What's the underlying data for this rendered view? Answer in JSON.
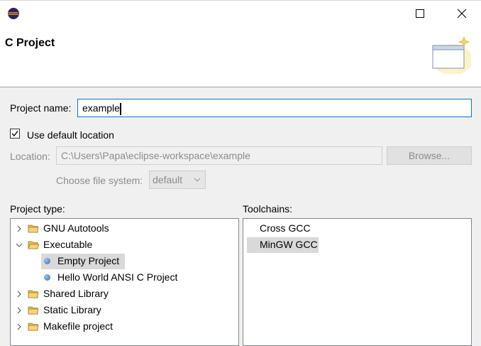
{
  "window": {
    "title": "C Project",
    "icon": "eclipse-icon",
    "controls": [
      "maximize-icon",
      "close-icon"
    ]
  },
  "form": {
    "project_name_label": "Project name:",
    "project_name_value": "example",
    "use_default_location_label": "Use default location",
    "use_default_location_checked": true,
    "location_label": "Location:",
    "location_value": "C:\\Users\\Papa\\eclipse-workspace\\example",
    "browse_label": "Browse...",
    "file_system_label": "Choose file system:",
    "file_system_value": "default"
  },
  "project_type": {
    "label": "Project type:",
    "items": [
      {
        "label": "GNU Autotools",
        "kind": "folder",
        "expanded": false
      },
      {
        "label": "Executable",
        "kind": "folder",
        "expanded": true
      },
      {
        "label": "Empty Project",
        "kind": "template",
        "selected": true
      },
      {
        "label": "Hello World ANSI C Project",
        "kind": "template",
        "selected": false
      },
      {
        "label": "Shared Library",
        "kind": "folder",
        "expanded": false
      },
      {
        "label": "Static Library",
        "kind": "folder",
        "expanded": false
      },
      {
        "label": "Makefile project",
        "kind": "folder",
        "expanded": false
      }
    ]
  },
  "toolchains": {
    "label": "Toolchains:",
    "items": [
      {
        "label": "Cross GCC",
        "selected": false
      },
      {
        "label": "MinGW GCC",
        "selected": true
      }
    ]
  },
  "colors": {
    "focus_border": "#0078d7",
    "selection": "#d9d9d9",
    "disabled_text": "#8c8c8c"
  }
}
